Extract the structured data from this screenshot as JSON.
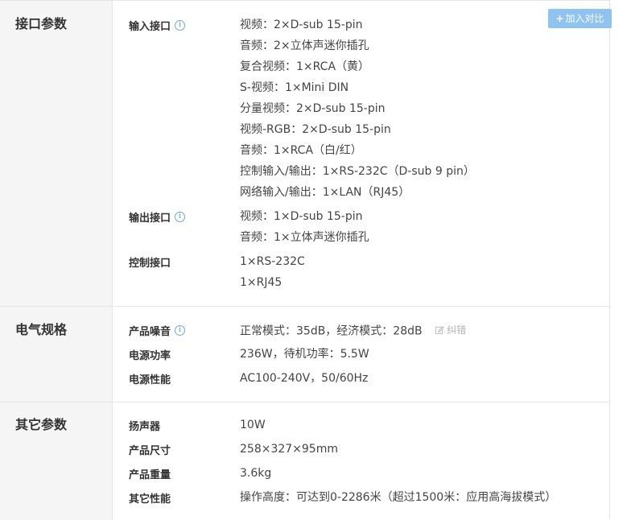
{
  "compare_button": {
    "icon": "+",
    "label": "加入对比"
  },
  "correct_link": {
    "label": "纠错"
  },
  "sections": [
    {
      "title": "接口参数",
      "params": [
        {
          "name": "输入接口",
          "info": true,
          "values": [
            "视频：2×D-sub 15-pin",
            "音频：2×立体声迷你插孔",
            "复合视频：1×RCA（黄）",
            "S-视频：1×Mini DIN",
            "分量视频：2×D-sub 15-pin",
            "视频-RGB：2×D-sub 15-pin",
            "音频：1×RCA（白/红）",
            "控制输入/输出：1×RS-232C（D-sub 9 pin）",
            "网络输入/输出：1×LAN（RJ45）"
          ]
        },
        {
          "name": "输出接口",
          "info": true,
          "values": [
            "视频：1×D-sub 15-pin",
            "音频：1×立体声迷你插孔"
          ]
        },
        {
          "name": "控制接口",
          "info": false,
          "values": [
            "1×RS-232C",
            "1×RJ45"
          ]
        }
      ]
    },
    {
      "title": "电气规格",
      "params": [
        {
          "name": "产品噪音",
          "info": true,
          "values": [
            "正常模式：35dB，经济模式：28dB"
          ]
        },
        {
          "name": "电源功率",
          "info": false,
          "values": [
            "236W，待机功率：5.5W"
          ]
        },
        {
          "name": "电源性能",
          "info": false,
          "values": [
            "AC100-240V，50/60Hz"
          ]
        }
      ]
    },
    {
      "title": "其它参数",
      "params": [
        {
          "name": "扬声器",
          "info": false,
          "values": [
            "10W"
          ]
        },
        {
          "name": "产品尺寸",
          "info": false,
          "values": [
            "258×327×95mm"
          ]
        },
        {
          "name": "产品重量",
          "info": false,
          "values": [
            "3.6kg"
          ]
        },
        {
          "name": "其它性能",
          "info": false,
          "values": [
            "操作高度：可达到0-2286米（超过1500米：应用高海拔模式）"
          ]
        }
      ]
    }
  ],
  "colors": {
    "category_bg": "#f5f5f5",
    "border": "#e4e4e4",
    "compare_button_bg": "#8ec3f2",
    "info_icon": "#4a90e2",
    "correct_link": "#b0b0b0"
  }
}
